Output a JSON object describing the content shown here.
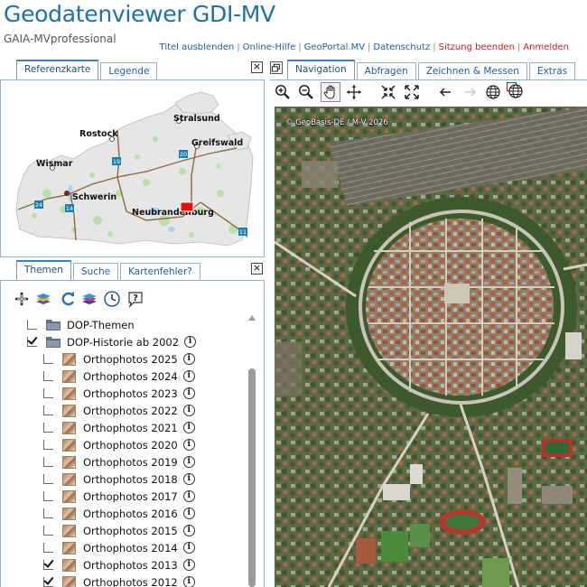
{
  "header": {
    "title": "Geodatenviewer GDI-MV",
    "subtitle": "GAIA-MVprofessional",
    "links": [
      {
        "label": "Titel ausblenden",
        "color": "#1f5fa0"
      },
      {
        "label": "Online-Hilfe",
        "color": "#1f5fa0"
      },
      {
        "label": "GeoPortal.MV",
        "color": "#1f5fa0"
      },
      {
        "label": "Datenschutz",
        "color": "#1f5fa0"
      },
      {
        "label": "Sitzung beenden",
        "color": "#d32020"
      },
      {
        "label": "Anmelden",
        "color": "#d32020"
      }
    ]
  },
  "ref_panel": {
    "tabs": [
      {
        "label": "Referenzkarte",
        "active": true
      },
      {
        "label": "Legende",
        "active": false
      }
    ],
    "close": "×",
    "cities": [
      "Rostock",
      "Stralsund",
      "Greifswald",
      "Wismar",
      "Schwerin",
      "Neubrandenburg"
    ],
    "road_shields": [
      "19",
      "20",
      "24",
      "14",
      "11"
    ]
  },
  "themes_panel": {
    "tabs": [
      {
        "label": "Themen",
        "active": true
      },
      {
        "label": "Suche",
        "active": false
      },
      {
        "label": "Kartenfehler?",
        "active": false
      }
    ],
    "close": "×",
    "toolbar_icons": [
      "add-layer-icon",
      "layers-icon",
      "refresh-icon",
      "layers-stack-icon",
      "clock-icon",
      "help-icon"
    ],
    "tree": [
      {
        "label": "DOP-Themen",
        "checked": false,
        "type": "folder",
        "indent": 0,
        "info": false
      },
      {
        "label": "DOP-Historie ab 2002",
        "checked": true,
        "type": "folder",
        "indent": 0,
        "info": true
      },
      {
        "label": "Orthophotos 2025",
        "checked": false,
        "type": "layer",
        "indent": 1,
        "info": true
      },
      {
        "label": "Orthophotos 2024",
        "checked": false,
        "type": "layer",
        "indent": 1,
        "info": true
      },
      {
        "label": "Orthophotos 2023",
        "checked": false,
        "type": "layer",
        "indent": 1,
        "info": true
      },
      {
        "label": "Orthophotos 2022",
        "checked": false,
        "type": "layer",
        "indent": 1,
        "info": true
      },
      {
        "label": "Orthophotos 2021",
        "checked": false,
        "type": "layer",
        "indent": 1,
        "info": true
      },
      {
        "label": "Orthophotos 2020",
        "checked": false,
        "type": "layer",
        "indent": 1,
        "info": true
      },
      {
        "label": "Orthophotos 2019",
        "checked": false,
        "type": "layer",
        "indent": 1,
        "info": true
      },
      {
        "label": "Orthophotos 2018",
        "checked": false,
        "type": "layer",
        "indent": 1,
        "info": true
      },
      {
        "label": "Orthophotos 2017",
        "checked": false,
        "type": "layer",
        "indent": 1,
        "info": true
      },
      {
        "label": "Orthophotos 2016",
        "checked": false,
        "type": "layer",
        "indent": 1,
        "info": true
      },
      {
        "label": "Orthophotos 2015",
        "checked": false,
        "type": "layer",
        "indent": 1,
        "info": true
      },
      {
        "label": "Orthophotos 2014",
        "checked": false,
        "type": "layer",
        "indent": 1,
        "info": true
      },
      {
        "label": "Orthophotos 2013",
        "checked": true,
        "type": "layer",
        "indent": 1,
        "info": true
      },
      {
        "label": "Orthophotos 2012",
        "checked": true,
        "type": "layer",
        "indent": 1,
        "info": true
      }
    ]
  },
  "map_panel": {
    "restore_icon": "restore-window-icon",
    "tabs": [
      {
        "label": "Navigation",
        "active": true
      },
      {
        "label": "Abfragen",
        "active": false
      },
      {
        "label": "Zeichnen & Messen",
        "active": false
      },
      {
        "label": "Extras",
        "active": false
      }
    ],
    "tools": [
      "zoom-in-icon",
      "zoom-out-icon",
      "pan-hand-icon",
      "move-arrows-icon",
      "zoom-full-icon",
      "zoom-extent-icon",
      "back-arrow-icon",
      "forward-arrow-icon",
      "globe-icon",
      "globe-red-icon"
    ],
    "copyright": "© GeoBasis-DE / M-V 2026"
  },
  "colors": {
    "accent": "#1f6fa8",
    "tab_border": "#8fb2d2",
    "link_red": "#d32020",
    "road_shield": "#1a7fb5"
  }
}
